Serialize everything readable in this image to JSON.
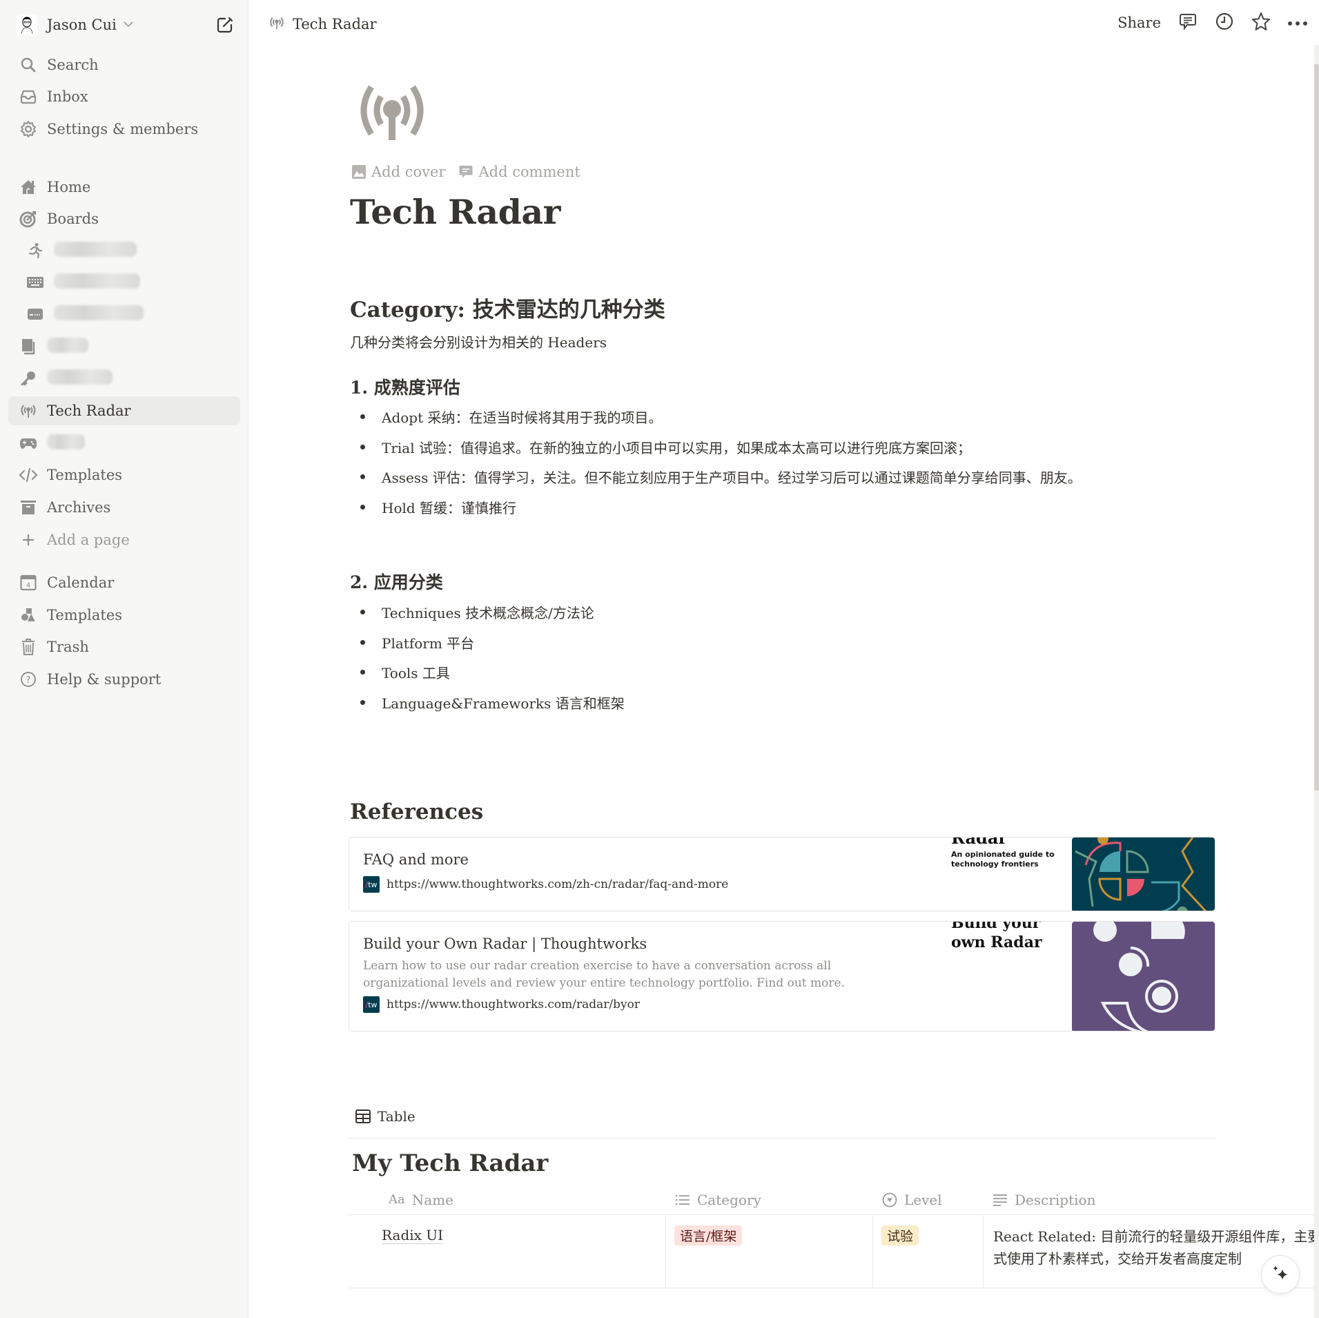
{
  "sidebar": {
    "workspace_name": "Jason Cui",
    "top_items": [
      {
        "label": "Search",
        "icon": "search-icon"
      },
      {
        "label": "Inbox",
        "icon": "inbox-icon"
      },
      {
        "label": "Settings & members",
        "icon": "gear-icon"
      }
    ],
    "pages": [
      {
        "label": "Home",
        "icon": "home-icon"
      },
      {
        "label": "Boards",
        "icon": "target-icon"
      },
      {
        "label": "[redacted]",
        "icon": "running-person-icon",
        "redacted": true,
        "sub": true
      },
      {
        "label": "[redacted]",
        "icon": "keyboard-icon",
        "redacted": true,
        "sub": true
      },
      {
        "label": "[redacted]",
        "icon": "card-icon",
        "redacted": true,
        "sub": true
      },
      {
        "label": "[redacted]",
        "icon": "book-icon",
        "redacted": true
      },
      {
        "label": "[redacted]",
        "icon": "key-icon",
        "redacted": true
      },
      {
        "label": "Tech Radar",
        "icon": "radar-icon",
        "active": true
      },
      {
        "label": "[redacted]",
        "icon": "gamepad-icon",
        "redacted": true
      },
      {
        "label": "Templates",
        "icon": "code-icon"
      },
      {
        "label": "Archives",
        "icon": "archive-icon"
      },
      {
        "label": "Add a page",
        "icon": "plus-icon"
      }
    ],
    "bottom_items": [
      {
        "label": "Calendar",
        "icon": "calendar-icon",
        "calendar_day": "4"
      },
      {
        "label": "Templates",
        "icon": "shapes-icon"
      },
      {
        "label": "Trash",
        "icon": "trash-icon"
      },
      {
        "label": "Help & support",
        "icon": "help-icon"
      }
    ]
  },
  "topbar": {
    "breadcrumb": "Tech Radar",
    "share_label": "Share"
  },
  "page": {
    "add_cover": "Add cover",
    "add_comment": "Add comment",
    "title": "Tech Radar",
    "category_heading": "Category: 技术雷达的几种分类",
    "category_desc": "几种分类将会分别设计为相关的 Headers",
    "section1": {
      "heading": "1. 成熟度评估",
      "items": [
        "Adopt 采纳：在适当时候将其用于我的项目。",
        "Trial 试验：值得追求。在新的独立的小项目中可以实用，如果成本太高可以进行兜底方案回滚；",
        "Assess 评估：值得学习，关注。但不能立刻应用于生产项目中。经过学习后可以通过课题简单分享给同事、朋友。",
        "Hold 暂缓：谨慎推行"
      ]
    },
    "section2": {
      "heading": "2. 应用分类",
      "items": [
        "Techniques 技术概念概念/方法论",
        "Platform 平台",
        "Tools 工具",
        "Language&Frameworks 语言和框架"
      ]
    },
    "references": {
      "heading": "References",
      "bookmarks": [
        {
          "title": "FAQ and more",
          "description": "",
          "url": "https://www.thoughtworks.com/zh-cn/radar/faq-and-more",
          "thumb_title": "Radar",
          "thumb_subtitle": "An opinionated guide to technology frontiers"
        },
        {
          "title": "Build your Own Radar | Thoughtworks",
          "description": "Learn how to use our radar creation exercise to have a conversation across all organizational levels and review your entire technology portfolio. Find out more.",
          "url": "https://www.thoughtworks.com/radar/byor",
          "thumb_title": "Build your own Radar",
          "thumb_subtitle": ""
        }
      ],
      "favicon_text": "tw"
    },
    "database": {
      "view_label": "Table",
      "title": "My Tech Radar",
      "columns": [
        {
          "label": "Name",
          "icon": "text-type-icon",
          "icon_text": "Aa"
        },
        {
          "label": "Category",
          "icon": "list-icon"
        },
        {
          "label": "Level",
          "icon": "select-icon"
        },
        {
          "label": "Description",
          "icon": "lines-icon"
        }
      ],
      "rows": [
        {
          "name": "Radix UI",
          "category": "语言/框架",
          "level": "试验",
          "description_line1": "React Related: 目前流行的轻量级开源组件库，主要",
          "description_line2": "式使用了朴素样式，交给开发者高度定制"
        }
      ]
    }
  },
  "colors": {
    "sidebar_bg": "#f7f7f5",
    "text": "#37352f",
    "muted": "#9b9a97",
    "category_tag_bg": "#ffe2dd",
    "category_tag_fg": "#5d1715",
    "level_tag_bg": "#fdecc8",
    "level_tag_fg": "#402c1b",
    "tw_brand": "#003d4f"
  }
}
